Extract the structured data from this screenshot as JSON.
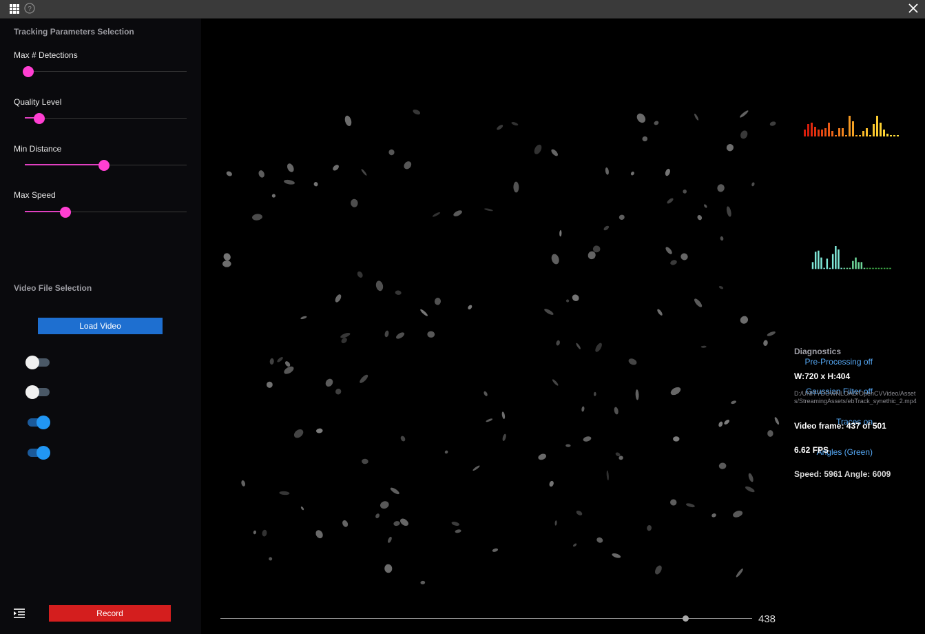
{
  "titlebar": {
    "apps_icon": "grid-icon",
    "help_icon": "help-circle-icon",
    "close_icon": "close-icon"
  },
  "tracking": {
    "title": "Tracking Parameters Selection",
    "params": [
      {
        "label": "Max # Detections",
        "value": 0.02
      },
      {
        "label": "Quality Level",
        "value": 0.09
      },
      {
        "label": "Min Distance",
        "value": 0.49
      },
      {
        "label": "Max Speed",
        "value": 0.25
      }
    ]
  },
  "video_file": {
    "title": "Video File Selection",
    "load_label": "Load Video",
    "toggles": [
      {
        "label": "Pre-Processing off",
        "on": false
      },
      {
        "label": "Gaussian Filter off",
        "on": false
      },
      {
        "label": "Traces on",
        "on": true
      },
      {
        "label": "Angles (Green)",
        "on": true
      }
    ]
  },
  "bottom": {
    "menu_icon": "menu-collapse-icon",
    "record_label": "Record",
    "frame_value": "438",
    "scrub_position": 0.874
  },
  "diagnostics": {
    "title": "Diagnostics",
    "size": "W:720 x H:404",
    "path": "D:/UNITYDOWNLOAD/OpenCVVideo/Assets/StreamingAssets/ebTrack_synethic_2.mp4",
    "frame": "Video frame: 437 of 501",
    "fps": "6.62 FPS",
    "speed_angle": "Speed: 5961 Angle: 6009"
  },
  "colors": {
    "accent_magenta": "#ff3fd2",
    "toggle_blue": "#2196f3",
    "load_blue": "#1e6fd0",
    "record_red": "#d41e1e"
  }
}
